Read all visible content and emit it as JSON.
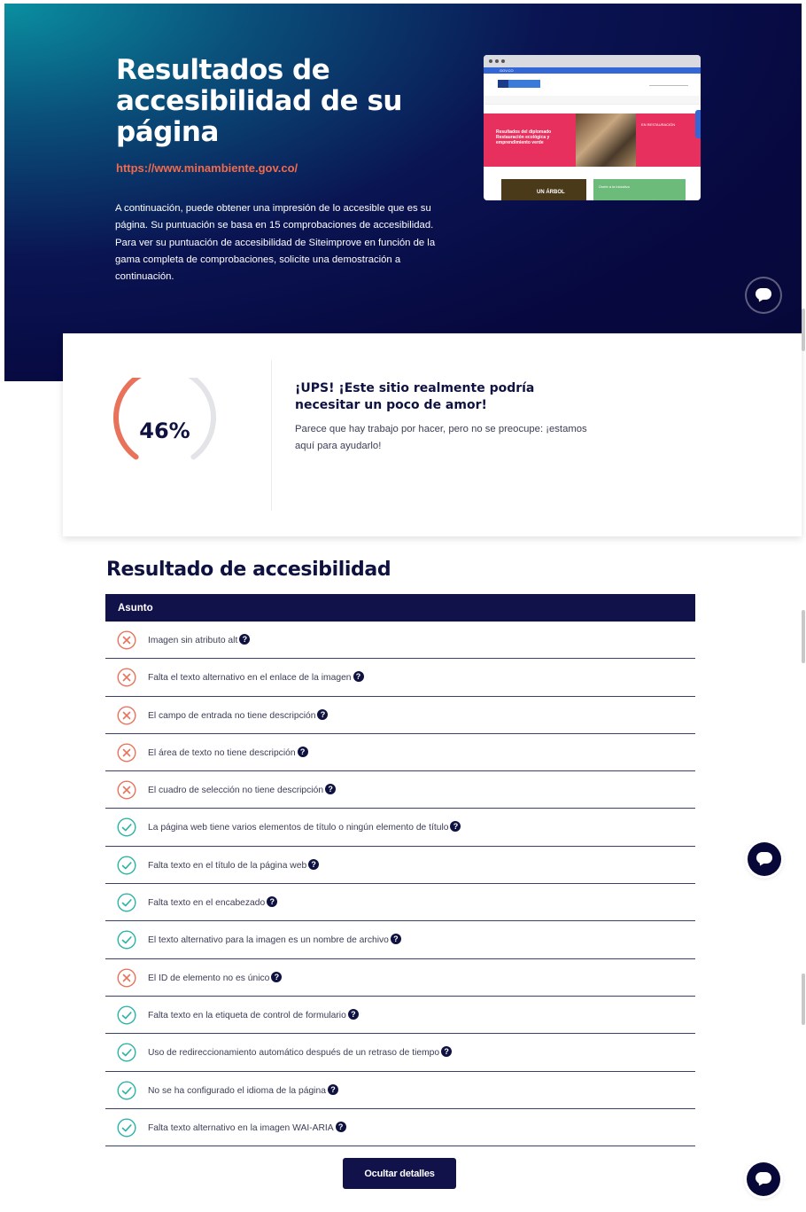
{
  "hero": {
    "title": "Resultados de accesibilidad de su página",
    "url": "https://www.minambiente.gov.co/",
    "description": "A continuación, puede obtener una impresión de lo accesible que es su página. Su puntuación se basa en 15 comprobaciones de accesibilidad. Para ver su puntuación de accesibilidad de Siteimprove en función de la gama completa de comprobaciones, solicite una demostración a continuación."
  },
  "preview": {
    "topbar_label": "GOV.CO",
    "hero_left": "Resultados del diplomado Restauración ecológica y emprendimiento verde",
    "hero_right": "EN RESTAURACIÓN",
    "tile_left": "UN ÁRBOL",
    "tile_right": "Únete a la iniciativa"
  },
  "score": {
    "value": "46%",
    "fraction": 0.46,
    "headline": "¡UPS! ¡Este sitio realmente podría necesitar un poco de amor!",
    "message": "Parece que hay trabajo por hacer, pero no se preocupe: ¡estamos aquí para ayudarlo!",
    "colors": {
      "progress": "#e8735a",
      "track": "#e3e4e8"
    }
  },
  "results": {
    "title": "Resultado de accesibilidad",
    "column_header": "Asunto",
    "items": [
      {
        "label": "Imagen sin atributo alt",
        "status": "fail"
      },
      {
        "label": "Falta el texto alternativo en el enlace de la imagen",
        "status": "fail"
      },
      {
        "label": "El campo de entrada no tiene descripción",
        "status": "fail"
      },
      {
        "label": "El área de texto no tiene descripción",
        "status": "fail"
      },
      {
        "label": "El cuadro de selección no tiene descripción",
        "status": "fail"
      },
      {
        "label": "La página web tiene varios elementos de título o ningún elemento de título",
        "status": "pass"
      },
      {
        "label": "Falta texto en el título de la página web",
        "status": "pass"
      },
      {
        "label": "Falta texto en el encabezado",
        "status": "pass"
      },
      {
        "label": "El texto alternativo para la imagen es un nombre de archivo",
        "status": "pass"
      },
      {
        "label": "El ID de elemento no es único",
        "status": "fail"
      },
      {
        "label": "Falta texto en la etiqueta de control de formulario",
        "status": "pass"
      },
      {
        "label": "Uso de redireccionamiento automático después de un retraso de tiempo",
        "status": "pass"
      },
      {
        "label": "No se ha configurado el idioma de la página",
        "status": "pass"
      },
      {
        "label": "Falta texto alternativo en la imagen WAI-ARIA",
        "status": "pass"
      }
    ],
    "help_glyph": "?",
    "colors": {
      "fail": "#e8735a",
      "pass": "#2ab3a6"
    }
  },
  "actions": {
    "hide_details": "Ocultar detalles"
  },
  "icons": {
    "chat": "chat-bubble-icon",
    "fail": "x-circle-icon",
    "pass": "check-circle-icon",
    "help": "question-icon"
  }
}
